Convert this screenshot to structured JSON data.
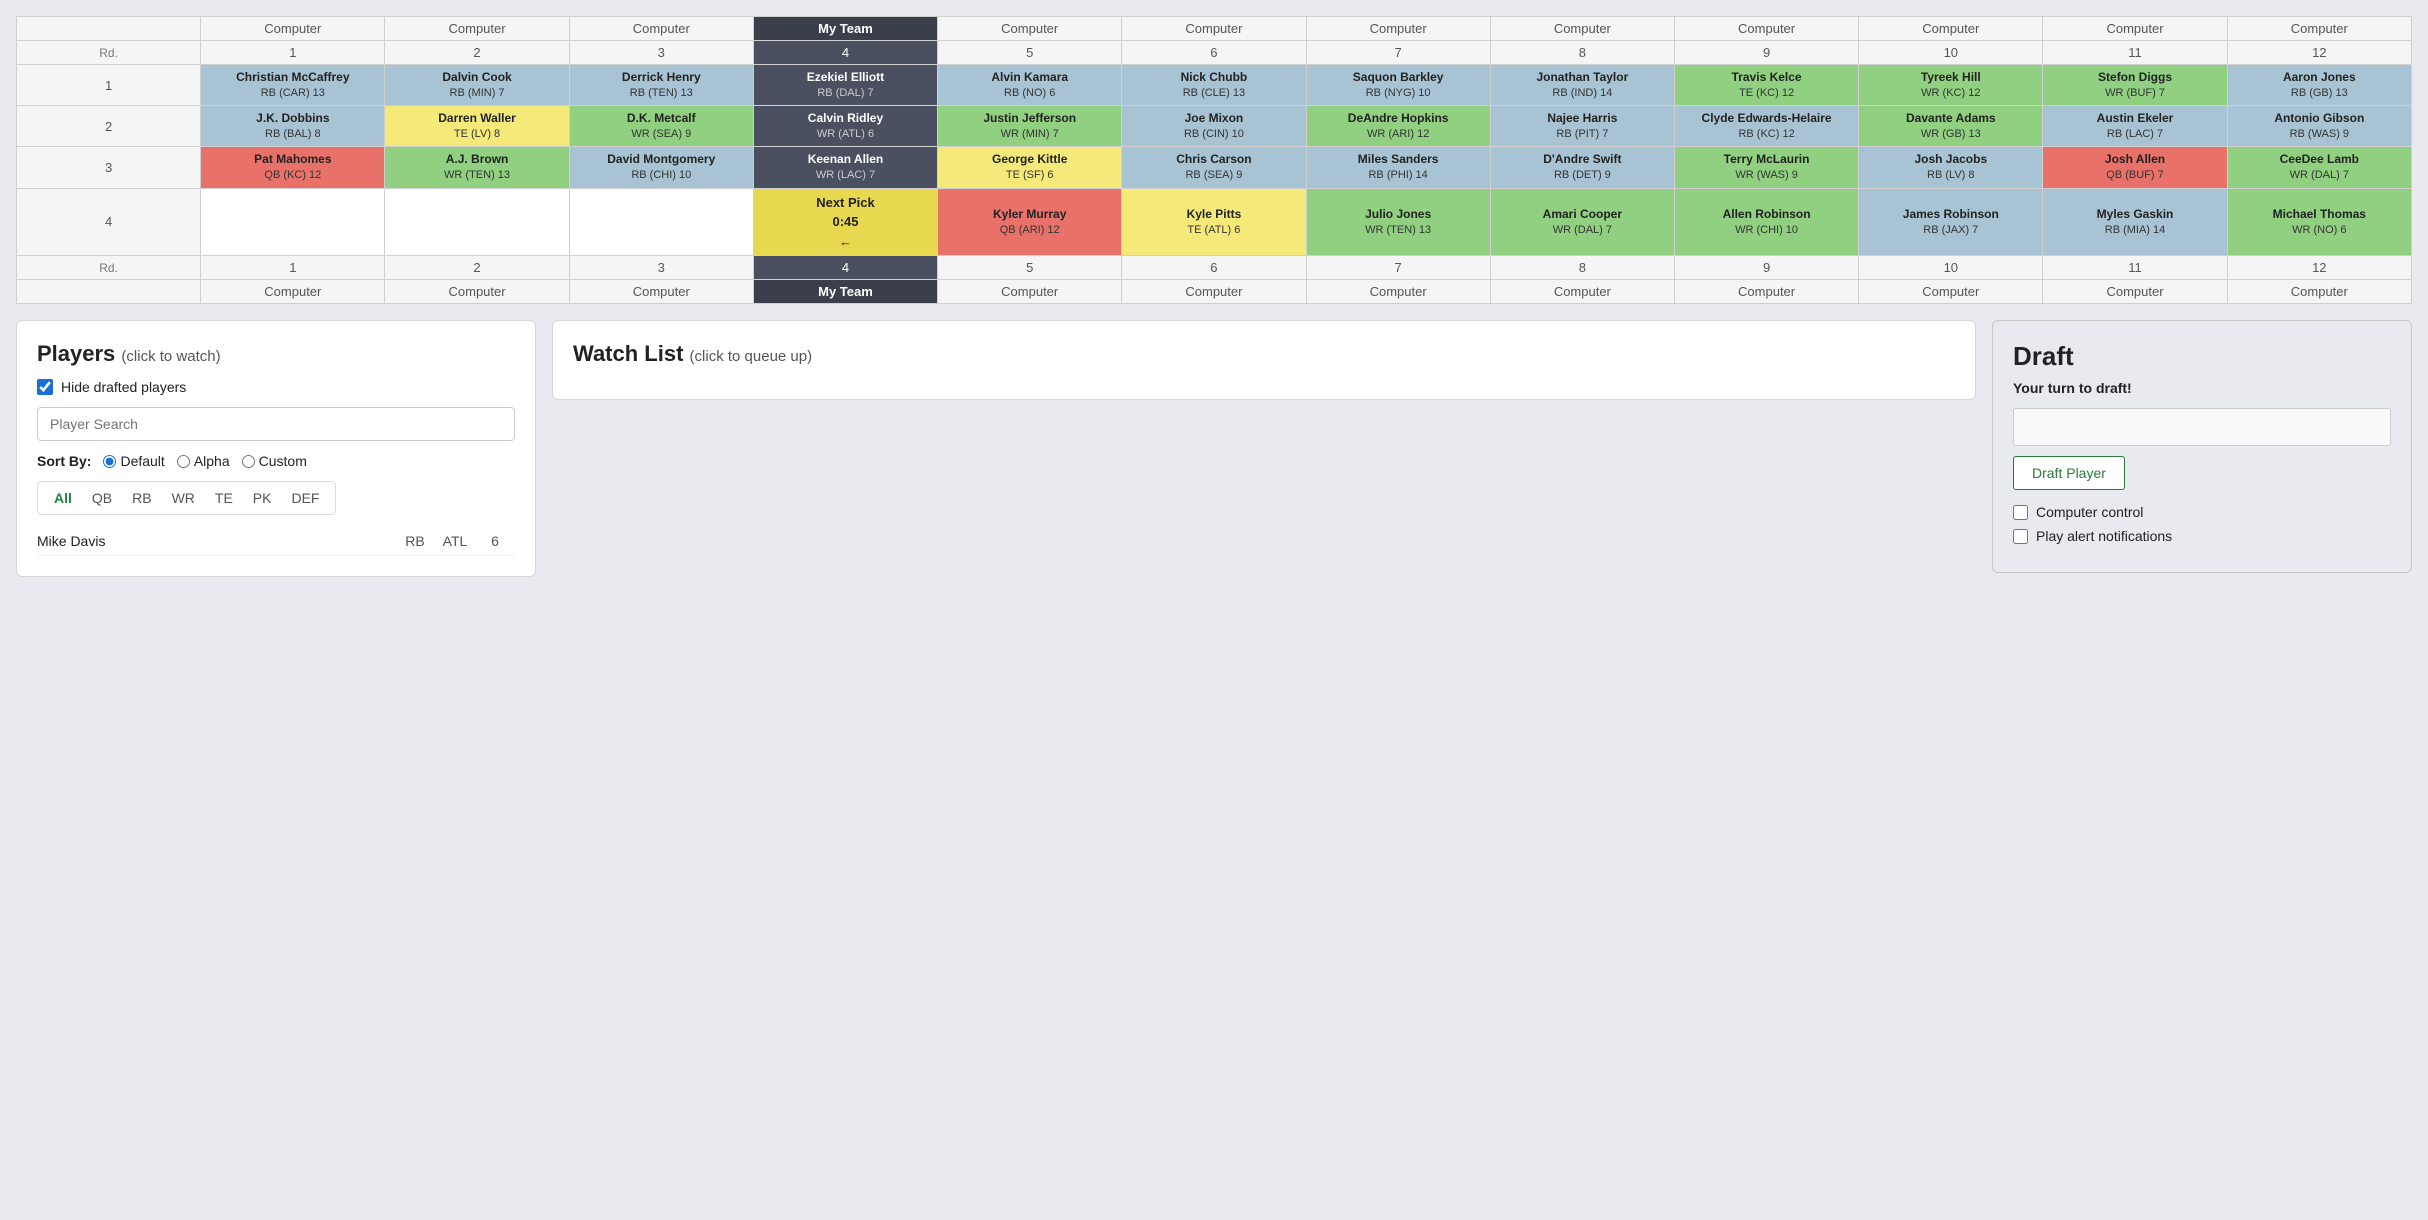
{
  "board": {
    "teams": [
      "Computer",
      "Computer",
      "Computer",
      "My Team",
      "Computer",
      "Computer",
      "Computer",
      "Computer",
      "Computer",
      "Computer",
      "Computer",
      "Computer"
    ],
    "team_numbers": [
      "1",
      "2",
      "3",
      "4",
      "5",
      "6",
      "7",
      "8",
      "9",
      "10",
      "11",
      "12"
    ],
    "rounds": [
      {
        "rd": "1",
        "picks": [
          {
            "name": "Christian McCaffrey",
            "pos_team": "RB (CAR) 13",
            "color": "blue"
          },
          {
            "name": "Dalvin Cook",
            "pos_team": "RB (MIN) 7",
            "color": "blue"
          },
          {
            "name": "Derrick Henry",
            "pos_team": "RB (TEN) 13",
            "color": "blue"
          },
          {
            "name": "Ezekiel Elliott",
            "pos_team": "RB (DAL) 7",
            "color": "myteam"
          },
          {
            "name": "Alvin Kamara",
            "pos_team": "RB (NO) 6",
            "color": "blue"
          },
          {
            "name": "Nick Chubb",
            "pos_team": "RB (CLE) 13",
            "color": "blue"
          },
          {
            "name": "Saquon Barkley",
            "pos_team": "RB (NYG) 10",
            "color": "blue"
          },
          {
            "name": "Jonathan Taylor",
            "pos_team": "RB (IND) 14",
            "color": "blue"
          },
          {
            "name": "Travis Kelce",
            "pos_team": "TE (KC) 12",
            "color": "green"
          },
          {
            "name": "Tyreek Hill",
            "pos_team": "WR (KC) 12",
            "color": "green"
          },
          {
            "name": "Stefon Diggs",
            "pos_team": "WR (BUF) 7",
            "color": "green"
          },
          {
            "name": "Aaron Jones",
            "pos_team": "RB (GB) 13",
            "color": "blue"
          }
        ]
      },
      {
        "rd": "2",
        "picks": [
          {
            "name": "J.K. Dobbins",
            "pos_team": "RB (BAL) 8",
            "color": "blue"
          },
          {
            "name": "Darren Waller",
            "pos_team": "TE (LV) 8",
            "color": "yellow"
          },
          {
            "name": "D.K. Metcalf",
            "pos_team": "WR (SEA) 9",
            "color": "green"
          },
          {
            "name": "Calvin Ridley",
            "pos_team": "WR (ATL) 6",
            "color": "myteam"
          },
          {
            "name": "Justin Jefferson",
            "pos_team": "WR (MIN) 7",
            "color": "green"
          },
          {
            "name": "Joe Mixon",
            "pos_team": "RB (CIN) 10",
            "color": "blue"
          },
          {
            "name": "DeAndre Hopkins",
            "pos_team": "WR (ARI) 12",
            "color": "green"
          },
          {
            "name": "Najee Harris",
            "pos_team": "RB (PIT) 7",
            "color": "blue"
          },
          {
            "name": "Clyde Edwards-Helaire",
            "pos_team": "RB (KC) 12",
            "color": "blue"
          },
          {
            "name": "Davante Adams",
            "pos_team": "WR (GB) 13",
            "color": "green"
          },
          {
            "name": "Austin Ekeler",
            "pos_team": "RB (LAC) 7",
            "color": "blue"
          },
          {
            "name": "Antonio Gibson",
            "pos_team": "RB (WAS) 9",
            "color": "blue"
          }
        ]
      },
      {
        "rd": "3",
        "picks": [
          {
            "name": "Pat Mahomes",
            "pos_team": "QB (KC) 12",
            "color": "red"
          },
          {
            "name": "A.J. Brown",
            "pos_team": "WR (TEN) 13",
            "color": "green"
          },
          {
            "name": "David Montgomery",
            "pos_team": "RB (CHI) 10",
            "color": "blue"
          },
          {
            "name": "Keenan Allen",
            "pos_team": "WR (LAC) 7",
            "color": "myteam"
          },
          {
            "name": "George Kittle",
            "pos_team": "TE (SF) 6",
            "color": "yellow"
          },
          {
            "name": "Chris Carson",
            "pos_team": "RB (SEA) 9",
            "color": "blue"
          },
          {
            "name": "Miles Sanders",
            "pos_team": "RB (PHI) 14",
            "color": "blue"
          },
          {
            "name": "D'Andre Swift",
            "pos_team": "RB (DET) 9",
            "color": "blue"
          },
          {
            "name": "Terry McLaurin",
            "pos_team": "WR (WAS) 9",
            "color": "green"
          },
          {
            "name": "Josh Jacobs",
            "pos_team": "RB (LV) 8",
            "color": "blue"
          },
          {
            "name": "Josh Allen",
            "pos_team": "QB (BUF) 7",
            "color": "red"
          },
          {
            "name": "CeeDee Lamb",
            "pos_team": "WR (DAL) 7",
            "color": "green"
          }
        ]
      },
      {
        "rd": "4",
        "picks": [
          {
            "name": "",
            "pos_team": "",
            "color": "empty"
          },
          {
            "name": "",
            "pos_team": "",
            "color": "empty"
          },
          {
            "name": "",
            "pos_team": "",
            "color": "empty"
          },
          {
            "name": "Next Pick 0:45 ←",
            "pos_team": "",
            "color": "next-pick"
          },
          {
            "name": "Kyler Murray",
            "pos_team": "QB (ARI) 12",
            "color": "red"
          },
          {
            "name": "Kyle Pitts",
            "pos_team": "TE (ATL) 6",
            "color": "yellow"
          },
          {
            "name": "Julio Jones",
            "pos_team": "WR (TEN) 13",
            "color": "green"
          },
          {
            "name": "Amari Cooper",
            "pos_team": "WR (DAL) 7",
            "color": "green"
          },
          {
            "name": "Allen Robinson",
            "pos_team": "WR (CHI) 10",
            "color": "green"
          },
          {
            "name": "James Robinson",
            "pos_team": "RB (JAX) 7",
            "color": "blue"
          },
          {
            "name": "Myles Gaskin",
            "pos_team": "RB (MIA) 14",
            "color": "blue"
          },
          {
            "name": "Michael Thomas",
            "pos_team": "WR (NO) 6",
            "color": "green"
          }
        ]
      }
    ]
  },
  "players_panel": {
    "title": "Players",
    "subtitle": "(click to watch)",
    "hide_drafted_label": "Hide drafted players",
    "hide_drafted_checked": true,
    "search_placeholder": "Player Search",
    "sort_by_label": "Sort By:",
    "sort_options": [
      "Default",
      "Alpha",
      "Custom"
    ],
    "sort_selected": "Default",
    "position_filters": [
      "All",
      "QB",
      "RB",
      "WR",
      "TE",
      "PK",
      "DEF"
    ],
    "active_filter": "All",
    "player_list": [
      {
        "name": "Mike Davis",
        "pos": "RB",
        "team": "ATL",
        "rank": "6"
      }
    ]
  },
  "watchlist_panel": {
    "title": "Watch List",
    "subtitle": "(click to queue up)"
  },
  "draft_panel": {
    "title": "Draft",
    "your_turn_label": "Your turn to draft!",
    "draft_input_placeholder": "",
    "draft_btn_label": "Draft Player",
    "computer_control_label": "Computer control",
    "play_alert_label": "Play alert notifications"
  }
}
